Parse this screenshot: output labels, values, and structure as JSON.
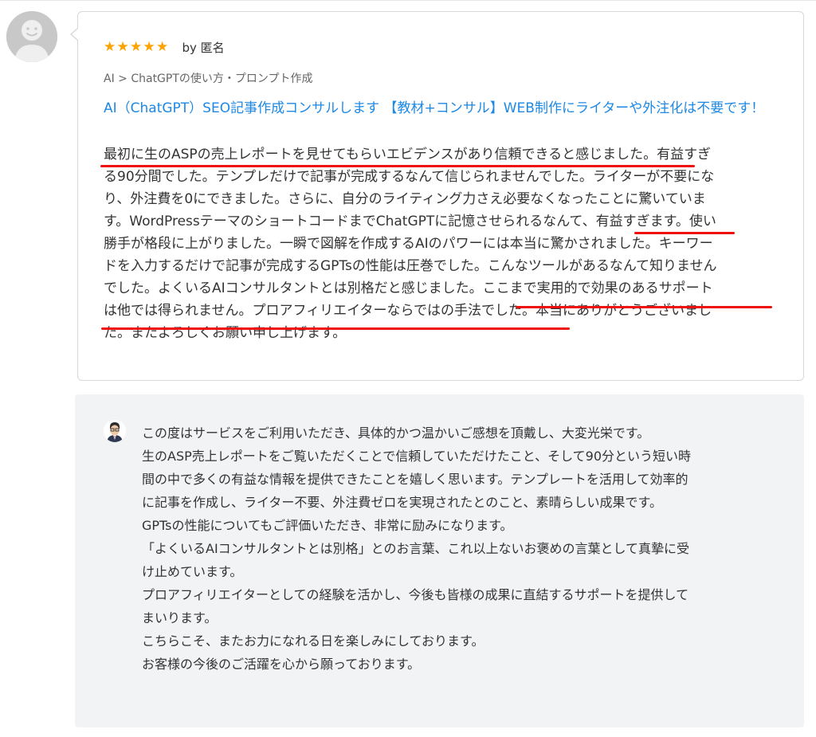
{
  "review": {
    "stars": "★★★★★",
    "rating": 5,
    "author": "by 匿名",
    "category": "AI > ChatGPTの使い方・プロンプト作成",
    "service_title": "AI（ChatGPT）SEO記事作成コンサルします 【教材+コンサル】WEB制作にライターや外注化は不要です！",
    "body_lines": [
      "最初に生のASPの売上レポートを見せてもらいエビデンスがあり信頼できると感じました。有益すぎ",
      "る90分間でした。テンプレだけで記事が完成するなんて信じられませんでした。ライターが不要にな",
      "り、外注費を0にできました。さらに、自分のライティング力さえ必要なくなったことに驚いていま",
      "す。WordPressテーマのショートコードまでChatGPTに記憶させられるなんて、有益すぎます。使い",
      "勝手が格段に上がりました。一瞬で図解を作成するAIのパワーには本当に驚かされました。キーワー",
      "ドを入力するだけで記事が完成するGPTsの性能は圧巻でした。こんなツールがあるなんて知りません",
      "でした。よくいるAIコンサルタントとは別格だと感じました。ここまで実用的で効果のあるサポート",
      "は他では得られません。プロアフィリエイターならではの手法でした。本当にありがとうございまし",
      "た。またよろしくお願い申し上げます。"
    ],
    "highlight_color": "#ee0f0f"
  },
  "reply": {
    "lines": [
      "この度はサービスをご利用いただき、具体的かつ温かいご感想を頂戴し、大変光栄です。",
      "生のASP売上レポートをご覧いただくことで信頼していただけたこと、そして90分という短い時",
      "間の中で多くの有益な情報を提供できたことを嬉しく思います。テンプレートを活用して効率的",
      "に記事を作成し、ライター不要、外注費ゼロを実現されたとのこと、素晴らしい成果です。",
      "GPTsの性能についてもご評価いただき、非常に励みになります。",
      "「よくいるAIコンサルタントとは別格」とのお言葉、これ以上ないお褒めの言葉として真摯に受",
      "け止めています。",
      "プロアフィリエイターとしての経験を活かし、今後も皆様の成果に直結するサポートを提供して",
      "まいります。",
      "こちらこそ、またお力になれる日を楽しみにしております。",
      "お客様の今後のご活躍を心から願っております。"
    ]
  },
  "colors": {
    "link": "#1e88e5",
    "star": "#ffa200",
    "reply_bg": "#f2f3f5",
    "card_border": "#d5d8dc"
  },
  "icons": {
    "reviewer_avatar": "default-user-avatar-icon",
    "seller_avatar": "seller-avatar-icon",
    "rating": "star-icon"
  }
}
